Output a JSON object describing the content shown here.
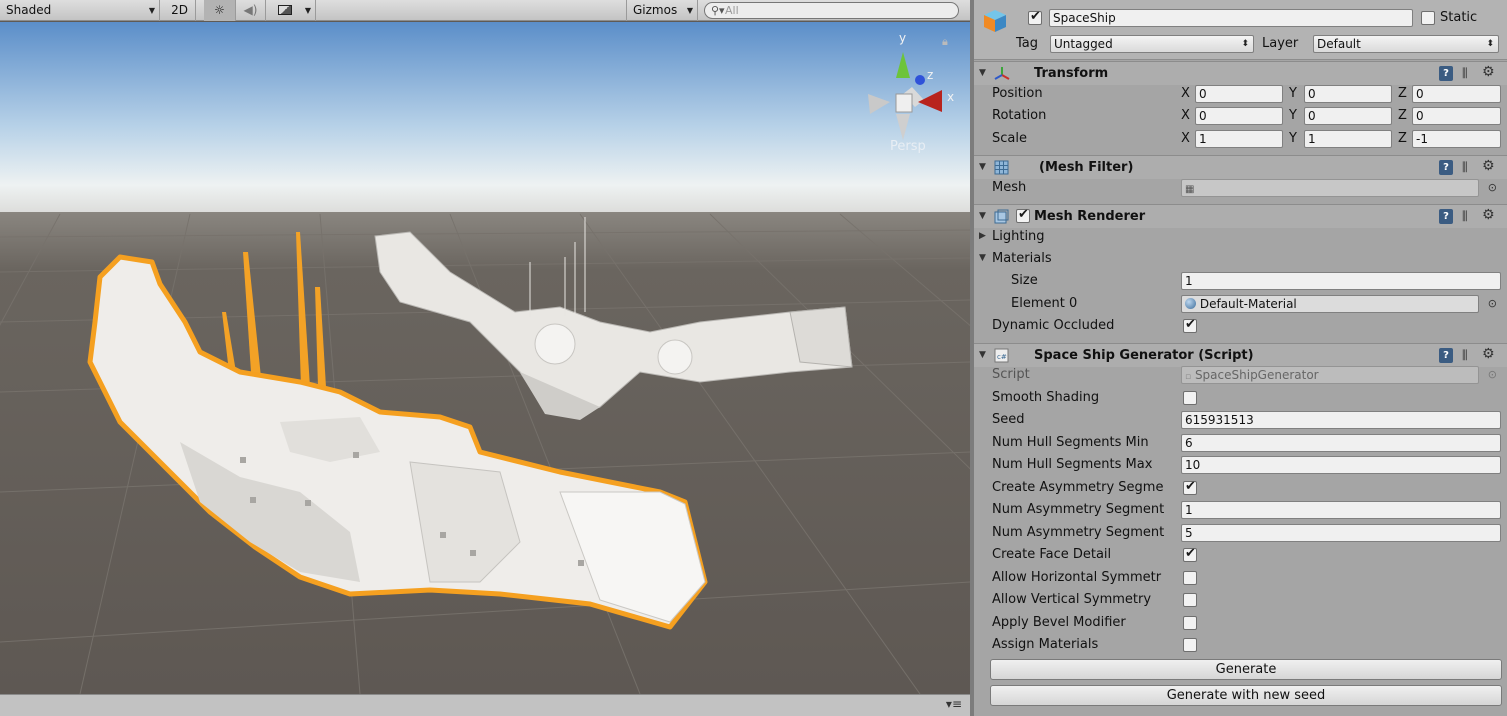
{
  "scene_toolbar": {
    "shading_mode": "Shaded",
    "mode_2d": "2D",
    "gizmos": "Gizmos",
    "search_placeholder": "All",
    "persp_label": "Persp",
    "gizmo_axes": {
      "y": "y",
      "z": "z",
      "x": "x"
    }
  },
  "object": {
    "active": true,
    "name": "SpaceShip",
    "static_label": "Static",
    "static": false,
    "tag_label": "Tag",
    "tag_value": "Untagged",
    "layer_label": "Layer",
    "layer_value": "Default"
  },
  "transform": {
    "title": "Transform",
    "axis_labels": [
      "X",
      "Y",
      "Z"
    ],
    "rows": [
      {
        "label": "Position",
        "x": "0",
        "y": "0",
        "z": "0"
      },
      {
        "label": "Rotation",
        "x": "0",
        "y": "0",
        "z": "0"
      },
      {
        "label": "Scale",
        "x": "1",
        "y": "1",
        "z": "-1"
      }
    ]
  },
  "mesh_filter": {
    "title": "(Mesh Filter)",
    "mesh_label": "Mesh",
    "mesh_value": ""
  },
  "mesh_renderer": {
    "title": "Mesh Renderer",
    "enabled": true,
    "lighting_label": "Lighting",
    "materials_label": "Materials",
    "size_label": "Size",
    "size_value": "1",
    "element0_label": "Element 0",
    "element0_value": "Default-Material",
    "dynamic_occluded_label": "Dynamic Occluded",
    "dynamic_occluded": true
  },
  "generator": {
    "title": "Space Ship Generator (Script)",
    "script_label": "Script",
    "script_value": "SpaceShipGenerator",
    "smooth_shading_label": "Smooth Shading",
    "smooth_shading": false,
    "seed_label": "Seed",
    "seed_value": "615931513",
    "hull_min_label": "Num Hull Segments Min",
    "hull_min_value": "6",
    "hull_max_label": "Num Hull Segments Max",
    "hull_max_value": "10",
    "create_asym_label": "Create Asymmetry Segme",
    "create_asym": true,
    "num_asym_min_label": "Num Asymmetry Segment",
    "num_asym_min_value": "1",
    "num_asym_max_label": "Num Asymmetry Segment",
    "num_asym_max_value": "5",
    "face_detail_label": "Create Face Detail",
    "face_detail": true,
    "horiz_sym_label": "Allow Horizontal Symmetr",
    "horiz_sym": false,
    "vert_sym_label": "Allow Vertical Symmetry",
    "vert_sym": false,
    "bevel_label": "Apply Bevel Modifier",
    "bevel": false,
    "assign_materials_label": "Assign Materials",
    "assign_materials": false,
    "generate_button": "Generate",
    "generate_new_seed_button": "Generate with new seed"
  },
  "colors": {
    "selection_outline": "#f5a020",
    "sky_top": "#5b8ec9",
    "ground": "#5f5a55",
    "inspector_bg": "#a5a5a5"
  }
}
